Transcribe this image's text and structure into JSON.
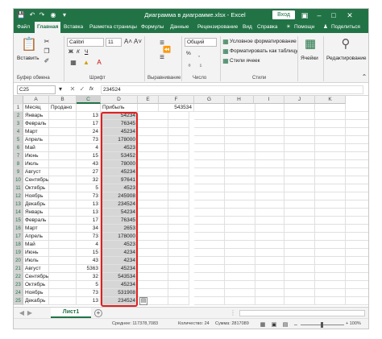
{
  "window": {
    "title": "Диаграмма в диаграмме.xlsx - Excel",
    "signin_label": "Вход",
    "icons": {
      "save": "save-icon",
      "undo": "undo-icon",
      "redo": "redo-icon",
      "camera": "camera-icon",
      "customize": "customize-qat-icon",
      "ribbon_display": "ribbon-display-icon",
      "minimize": "minimize-icon",
      "maximize": "maximize-icon",
      "close": "close-icon"
    }
  },
  "ribbon_tabs": [
    "Файл",
    "Главная",
    "Вставка",
    "Разметка страницы",
    "Формулы",
    "Данные",
    "Рецензирование",
    "Вид",
    "Справка",
    "Помощн",
    "Поделиться"
  ],
  "active_tab": "Главная",
  "ribbon": {
    "clipboard": {
      "paste_label": "Вставить",
      "group_label": "Буфер обмена"
    },
    "font": {
      "font_name": "Calibri",
      "font_size": "11",
      "bold": "Ж",
      "italic": "К",
      "underline": "Ч",
      "group_label": "Шрифт"
    },
    "alignment": {
      "group_label": "Выравнивание"
    },
    "number": {
      "format": "Общий",
      "group_label": "Число",
      "percent": "%"
    },
    "styles": {
      "conditional": "Условное форматирование",
      "as_table": "Форматировать как таблицу",
      "cell_styles": "Стили ячеек",
      "group_label": "Стили"
    },
    "cells": {
      "label": "Ячейки"
    },
    "editing": {
      "label": "Редактирование"
    }
  },
  "formula_bar": {
    "name_box": "C25",
    "fx": "fx",
    "value": "234524"
  },
  "grid": {
    "columns": [
      "A",
      "B",
      "C",
      "D",
      "E",
      "F",
      "G",
      "H",
      "I",
      "J",
      "K"
    ],
    "selected_column": "C",
    "header_row": {
      "a": "Месяц",
      "b": "Продано",
      "c": "Прибыль"
    },
    "e1_value": "543534",
    "rows": [
      {
        "n": "2",
        "a": "Январь",
        "b": "13",
        "c": "54234"
      },
      {
        "n": "3",
        "a": "Февраль",
        "b": "17",
        "c": "76345"
      },
      {
        "n": "4",
        "a": "Март",
        "b": "24",
        "c": "45234"
      },
      {
        "n": "5",
        "a": "Апрель",
        "b": "73",
        "c": "178000"
      },
      {
        "n": "6",
        "a": "Май",
        "b": "4",
        "c": "4523"
      },
      {
        "n": "7",
        "a": "Июнь",
        "b": "15",
        "c": "53452"
      },
      {
        "n": "8",
        "a": "Июль",
        "b": "43",
        "c": "78000"
      },
      {
        "n": "9",
        "a": "Август",
        "b": "27",
        "c": "45234"
      },
      {
        "n": "10",
        "a": "Сентябрь",
        "b": "32",
        "c": "97641"
      },
      {
        "n": "11",
        "a": "Октябрь",
        "b": "5",
        "c": "4523"
      },
      {
        "n": "12",
        "a": "Ноябрь",
        "b": "73",
        "c": "245908"
      },
      {
        "n": "13",
        "a": "Декабрь",
        "b": "13",
        "c": "234524"
      },
      {
        "n": "14",
        "a": "Январь",
        "b": "13",
        "c": "54234"
      },
      {
        "n": "15",
        "a": "Февраль",
        "b": "17",
        "c": "76345"
      },
      {
        "n": "16",
        "a": "Март",
        "b": "34",
        "c": "2653"
      },
      {
        "n": "17",
        "a": "Апрель",
        "b": "73",
        "c": "178000"
      },
      {
        "n": "18",
        "a": "Май",
        "b": "4",
        "c": "4523"
      },
      {
        "n": "19",
        "a": "Июнь",
        "b": "15",
        "c": "4234"
      },
      {
        "n": "20",
        "a": "Июль",
        "b": "43",
        "c": "4234"
      },
      {
        "n": "21",
        "a": "Август",
        "b": "5363",
        "c": "45234"
      },
      {
        "n": "22",
        "a": "Сентябрь",
        "b": "32",
        "c": "543534"
      },
      {
        "n": "23",
        "a": "Октябрь",
        "b": "5",
        "c": "45234"
      },
      {
        "n": "24",
        "a": "Ноябрь",
        "b": "73",
        "c": "531908"
      },
      {
        "n": "25",
        "a": "Декабрь",
        "b": "13",
        "c": "234524"
      }
    ]
  },
  "sheet_tabs": {
    "active": "Лист1",
    "add": "+"
  },
  "status_bar": {
    "average": "Среднее: 117378,7083",
    "count": "Количество: 24",
    "sum": "Сумма: 2817089",
    "zoom": "+ 100%"
  },
  "colors": {
    "brand": "#217346",
    "highlight": "#e02020",
    "selection": "#d6d6d6"
  }
}
